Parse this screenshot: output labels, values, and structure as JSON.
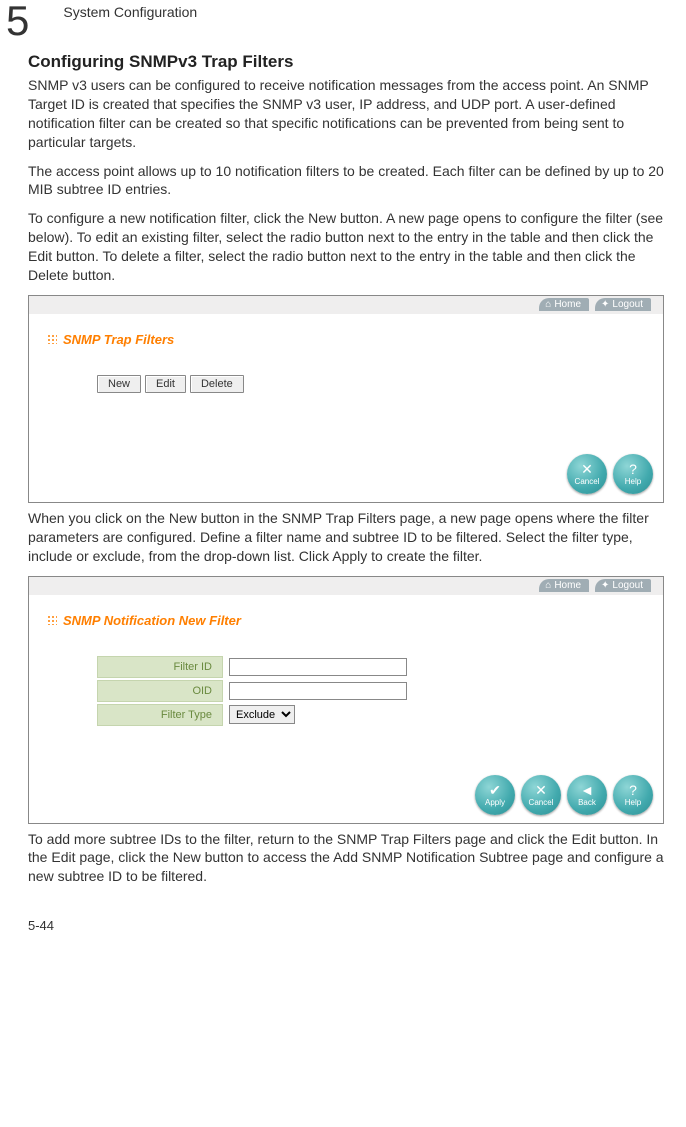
{
  "chapter": {
    "num": "5",
    "title": "System Configuration"
  },
  "section": {
    "title": "Configuring SNMPv3 Trap Filters"
  },
  "para": {
    "p1": "SNMP v3 users can be configured to receive notification messages from the access point. An SNMP Target ID is created that specifies the SNMP v3 user, IP address, and UDP port. A user-defined notification filter can be created so that specific notifications can be prevented from being sent to particular targets.",
    "p2": "The access point allows up to 10 notification filters to be created. Each filter can be defined by up to 20 MIB subtree ID entries.",
    "p3": "To configure a new notification filter, click the New button. A new page opens to configure the filter (see below). To edit an existing filter, select the radio button next to the entry in the table and then click the Edit button. To delete a filter, select the radio button next to the entry in the table and then click the Delete button.",
    "p4": "When you click on the New button in the SNMP Trap Filters page, a new page opens where the filter parameters are configured. Define a filter name and subtree ID to be filtered. Select the filter type, include or exclude, from the drop-down list. Click Apply to create the filter.",
    "p5": "To add more subtree IDs to the filter, return to the SNMP Trap Filters page and click the Edit button. In the Edit page, click the New button to access the Add SNMP Notification Subtree page and configure a new subtree ID to be filtered."
  },
  "ss1": {
    "top": {
      "home": "Home",
      "logout": "Logout"
    },
    "heading": "SNMP Trap Filters",
    "buttons": {
      "new": "New",
      "edit": "Edit",
      "delete": "Delete"
    },
    "round": {
      "cancel": "Cancel",
      "help": "Help"
    }
  },
  "ss2": {
    "top": {
      "home": "Home",
      "logout": "Logout"
    },
    "heading": "SNMP Notification New Filter",
    "labels": {
      "filterid": "Filter ID",
      "oid": "OID",
      "filtertype": "Filter Type"
    },
    "select": {
      "exclude": "Exclude"
    },
    "round": {
      "apply": "Apply",
      "cancel": "Cancel",
      "back": "Back",
      "help": "Help"
    }
  },
  "pagenum": "5-44"
}
